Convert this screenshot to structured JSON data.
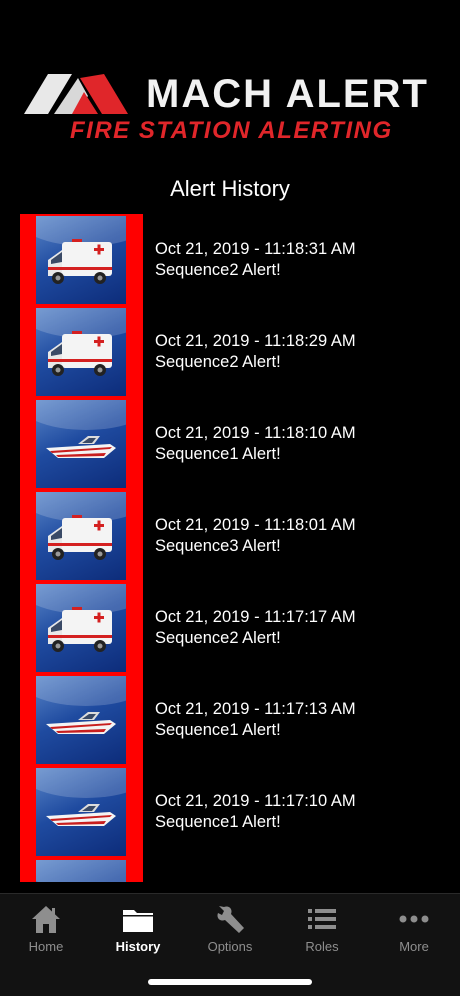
{
  "brand": {
    "title": "MACH ALERT",
    "subtitle": "FIRE STATION ALERTING",
    "accent": "#e0262a"
  },
  "page": {
    "title": "Alert History"
  },
  "alerts": [
    {
      "icon": "ambulance-icon",
      "timestamp": "Oct 21, 2019 - 11:18:31 AM",
      "message": "Sequence2 Alert!"
    },
    {
      "icon": "ambulance-icon",
      "timestamp": "Oct 21, 2019 - 11:18:29 AM",
      "message": "Sequence2 Alert!"
    },
    {
      "icon": "boat-icon",
      "timestamp": "Oct 21, 2019 - 11:18:10 AM",
      "message": "Sequence1 Alert!"
    },
    {
      "icon": "ambulance-icon",
      "timestamp": "Oct 21, 2019 - 11:18:01 AM",
      "message": "Sequence3 Alert!"
    },
    {
      "icon": "ambulance-icon",
      "timestamp": "Oct 21, 2019 - 11:17:17 AM",
      "message": "Sequence2 Alert!"
    },
    {
      "icon": "boat-icon",
      "timestamp": "Oct 21, 2019 - 11:17:13 AM",
      "message": "Sequence1 Alert!"
    },
    {
      "icon": "boat-icon",
      "timestamp": "Oct 21, 2019 - 11:17:10 AM",
      "message": "Sequence1 Alert!"
    },
    {
      "icon": "ambulance-icon",
      "timestamp": "",
      "message": ""
    }
  ],
  "tabs": [
    {
      "label": "Home",
      "icon": "home-icon",
      "active": false
    },
    {
      "label": "History",
      "icon": "folder-icon",
      "active": true
    },
    {
      "label": "Options",
      "icon": "wrench-icon",
      "active": false
    },
    {
      "label": "Roles",
      "icon": "list-icon",
      "active": false
    },
    {
      "label": "More",
      "icon": "more-icon",
      "active": false
    }
  ],
  "colors": {
    "background": "#000000",
    "alert_strip": "#ff0000",
    "thumb_blue": "#1f4ba0",
    "tab_inactive": "#8e8e8e",
    "tab_active": "#ffffff"
  }
}
